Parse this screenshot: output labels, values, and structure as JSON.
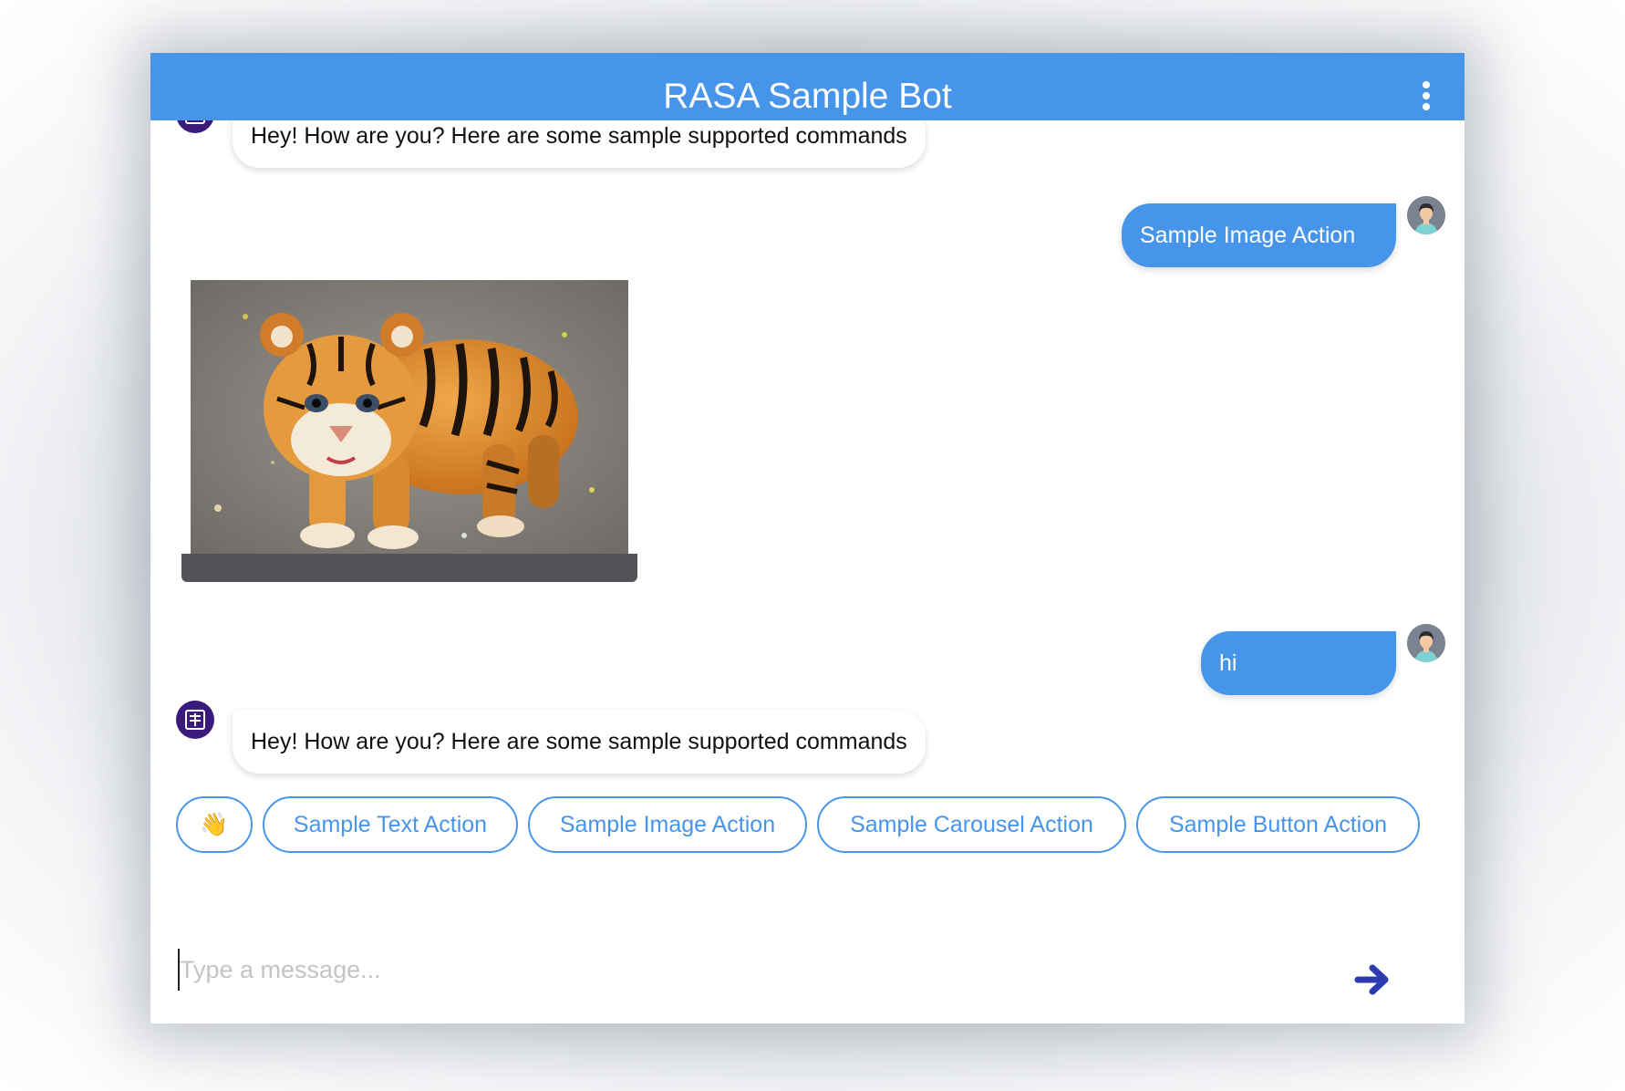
{
  "header": {
    "title": "RASA Sample Bot",
    "menu_icon": "more-vertical-icon"
  },
  "messages": [
    {
      "sender": "bot",
      "text": "Hey! How are you? Here are some sample supported commands"
    },
    {
      "sender": "user",
      "text": "Sample Image Action"
    },
    {
      "sender": "bot",
      "type": "image",
      "image_subject": "tiger cub"
    },
    {
      "sender": "user",
      "text": "hi"
    },
    {
      "sender": "bot",
      "text": "Hey! How are you? Here are some sample supported commands"
    }
  ],
  "suggestions": [
    {
      "label": "👋"
    },
    {
      "label": "Sample Text Action"
    },
    {
      "label": "Sample Image Action"
    },
    {
      "label": "Sample Carousel Action"
    },
    {
      "label": "Sample Button Action"
    }
  ],
  "composer": {
    "placeholder": "Type a message...",
    "send_icon": "arrow-right-icon"
  },
  "colors": {
    "header": "#4695ea",
    "user_bubble": "#4695ea",
    "bot_avatar": "#3a1a7a",
    "send_arrow": "#2c3cb0",
    "image_footer": "#545458"
  }
}
